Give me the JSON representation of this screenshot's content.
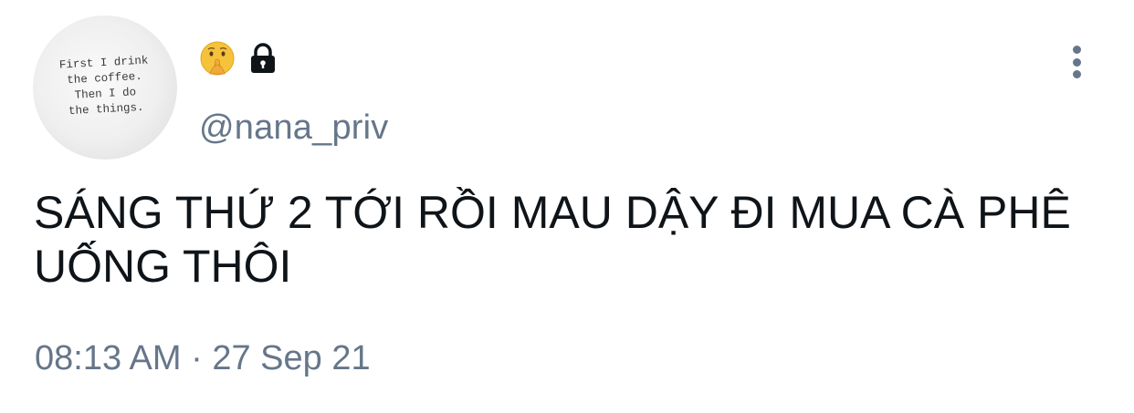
{
  "avatar": {
    "mug_text": "First I drink\nthe coffee.\nThen I do\nthe things."
  },
  "user": {
    "display_emoji": "shushing-face-icon",
    "lock": "lock-icon",
    "handle": "@nana_priv"
  },
  "tweet": {
    "text": "SÁNG THỨ 2 TỚI RỒI MAU DẬY ĐI MUA CÀ PHÊ UỐNG THÔI",
    "timestamp": "08:13 AM · 27 Sep 21"
  },
  "colors": {
    "text": "#0f1419",
    "secondary": "#66768a",
    "emoji": "#f5c33b"
  }
}
